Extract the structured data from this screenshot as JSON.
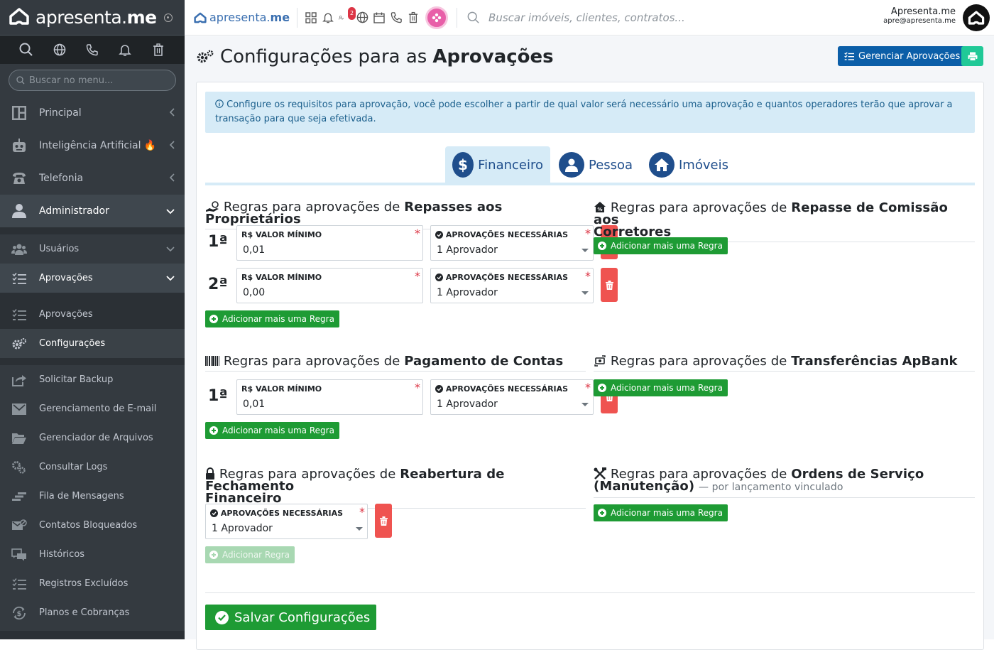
{
  "sidebar": {
    "brand": "apresenta.me",
    "search_placeholder": "Buscar no menu...",
    "items": [
      {
        "label": "Principal"
      },
      {
        "label": "Inteligência Artificial 🔥"
      },
      {
        "label": "Telefonia"
      },
      {
        "label": "Administrador"
      }
    ],
    "admin_sub": [
      {
        "label": "Usuários"
      },
      {
        "label": "Aprovações"
      },
      {
        "label": "Aprovações"
      },
      {
        "label": "Configurações"
      },
      {
        "label": "Solicitar Backup"
      },
      {
        "label": "Gerenciamento de E-mail"
      },
      {
        "label": "Gerenciador de Arquivos"
      },
      {
        "label": "Consultar Logs"
      },
      {
        "label": "Fila de Mensagens"
      },
      {
        "label": "Contatos Bloqueados"
      },
      {
        "label": "Históricos"
      },
      {
        "label": "Registros Excluídos"
      },
      {
        "label": "Planos e Cobranças"
      }
    ]
  },
  "topbar": {
    "brand": "apresenta.me",
    "badge_count": "2",
    "search_placeholder": "Buscar imóveis, clientes, contratos...",
    "user_name": "Apresenta.me",
    "user_email": "apre@apresenta.me"
  },
  "page": {
    "title_prefix": "Configurações para as",
    "title_bold": "Aprovações",
    "manage_button": "Gerenciar Aprovações",
    "info": "Configure os requisitos para aprovação, você pode escolher a partir de qual valor será necessário uma aprovação e quantos operadores terão que aprovar a transação para que seja efetivada.",
    "tabs": [
      {
        "label": "Financeiro",
        "active": true
      },
      {
        "label": "Pessoa",
        "active": false
      },
      {
        "label": "Imóveis",
        "active": false
      }
    ],
    "rules_prefix": "Regras para aprovações de",
    "labels": {
      "min_value": "VALOR MÍNIMO",
      "currency": "R$",
      "approvals": "APROVAÇÕES NECESSÁRIAS",
      "add_rule": "Adicionar mais uma Regra",
      "add_rule_short": "Adicionar Regra",
      "required_mark": "*"
    },
    "sections": {
      "repasses": {
        "title": "Repasses aos Proprietários",
        "rules": [
          {
            "order": "1ª",
            "min_value": "0,01",
            "approvals": "1 Aprovador"
          },
          {
            "order": "2ª",
            "min_value": "0,00",
            "approvals": "1 Aprovador"
          }
        ]
      },
      "comissao": {
        "title_line1": "Repasse de Comissão aos",
        "title_line2": "Corretores"
      },
      "pagamento": {
        "title": "Pagamento de Contas",
        "rules": [
          {
            "order": "1ª",
            "min_value": "0,01",
            "approvals": "1 Aprovador"
          }
        ]
      },
      "transferencias": {
        "title": "Transferências ApBank"
      },
      "reabertura": {
        "title_line1": "Reabertura de Fechamento",
        "title_line2": "Financeiro",
        "approvals": "1 Aprovador"
      },
      "ordens": {
        "title_line1": "Ordens de Serviço",
        "title_line2": "(Manutenção)",
        "note": "— por lançamento vinculado"
      }
    },
    "save_button": "Salvar Configurações"
  },
  "colors": {
    "sidebar_bg": "#343a40",
    "primary": "#0b5ea8",
    "success": "#1e9b34",
    "danger": "#ef5350",
    "info_bg": "#d6ebf7"
  }
}
